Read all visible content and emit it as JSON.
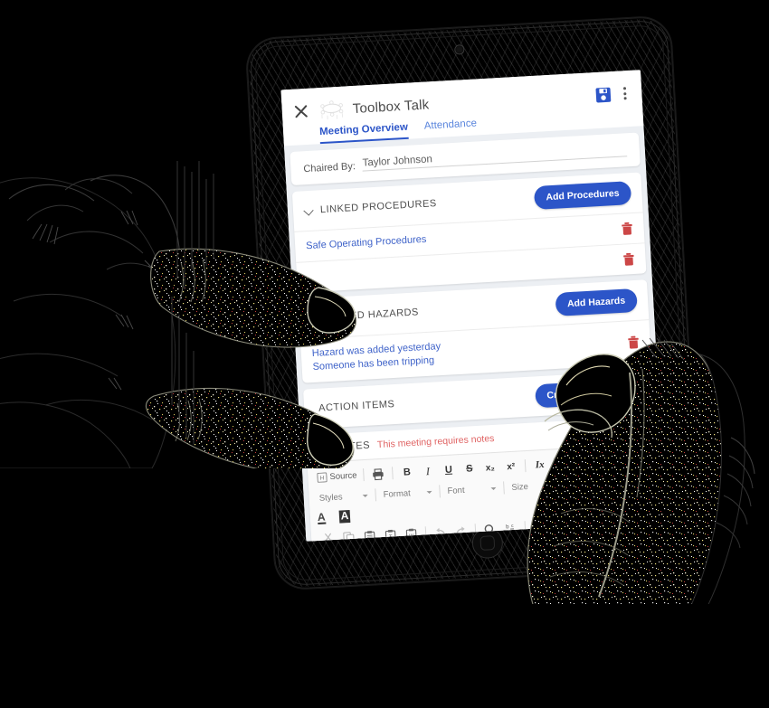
{
  "app": {
    "title": "Toolbox Talk",
    "icons": {
      "close": "close-icon",
      "logo": "meeting-table-icon",
      "save": "save-disk-icon",
      "more": "more-vertical-icon"
    },
    "tabs": [
      {
        "label": "Meeting Overview",
        "active": true
      },
      {
        "label": "Attendance",
        "active": false
      }
    ],
    "chaired_by": {
      "label": "Chaired By:",
      "value": "Taylor Johnson"
    },
    "sections": [
      {
        "id": "linked-procedures",
        "title": "LINKED PROCEDURES",
        "button": "Add Procedures",
        "rows": [
          {
            "text": "Safe Operating Procedures",
            "delete": "delete-icon"
          },
          {
            "text": "",
            "delete": "delete-icon"
          }
        ]
      },
      {
        "id": "linked-hazards",
        "title": "LINKED HAZARDS",
        "button": "Add Hazards",
        "rows": [
          {
            "text": "Hazard was added yesterday\nSomeone has been tripping",
            "delete": "delete-icon"
          }
        ]
      },
      {
        "id": "action-items",
        "title": "ACTION ITEMS",
        "button": "Create Action Item",
        "rows": []
      }
    ],
    "notes": {
      "title": "NOTES",
      "warning": "This meeting requires notes"
    },
    "editor": {
      "row1": [
        {
          "name": "source-button",
          "label": "Source"
        },
        {
          "name": "print-button",
          "label": ""
        },
        {
          "name": "bold-button",
          "label": "B"
        },
        {
          "name": "italic-button",
          "label": "I"
        },
        {
          "name": "underline-button",
          "label": "U"
        },
        {
          "name": "strikethrough-button",
          "label": "S"
        },
        {
          "name": "subscript-button",
          "label": "x₂"
        },
        {
          "name": "superscript-button",
          "label": "x²"
        },
        {
          "name": "remove-format-button",
          "label": "Ix"
        }
      ],
      "dropdowns": [
        {
          "name": "styles-dropdown",
          "label": "Styles"
        },
        {
          "name": "format-dropdown",
          "label": "Format"
        },
        {
          "name": "font-dropdown",
          "label": "Font"
        },
        {
          "name": "size-dropdown",
          "label": "Size"
        }
      ],
      "colors": [
        {
          "name": "text-color-button",
          "label": "A"
        },
        {
          "name": "background-color-button",
          "label": "A"
        }
      ],
      "row3": [
        {
          "name": "cut-button"
        },
        {
          "name": "copy-button"
        },
        {
          "name": "paste-button"
        },
        {
          "name": "paste-text-button"
        },
        {
          "name": "paste-word-button"
        },
        {
          "name": "undo-button"
        },
        {
          "name": "redo-button"
        },
        {
          "name": "find-button"
        },
        {
          "name": "replace-button"
        },
        {
          "name": "show-blocks-button"
        },
        {
          "name": "table-button"
        },
        {
          "name": "horizontal-rule-button"
        },
        {
          "name": "smiley-button"
        }
      ]
    }
  },
  "colors": {
    "accent": "#2c55c8",
    "tab_inactive": "#5b86dd",
    "link": "#3f63c9",
    "warning": "#e06464",
    "delete": "#cc4646",
    "background": "#000000"
  },
  "device": {
    "type": "tablet",
    "camera": "camera-dot",
    "home_button": "home-button"
  }
}
